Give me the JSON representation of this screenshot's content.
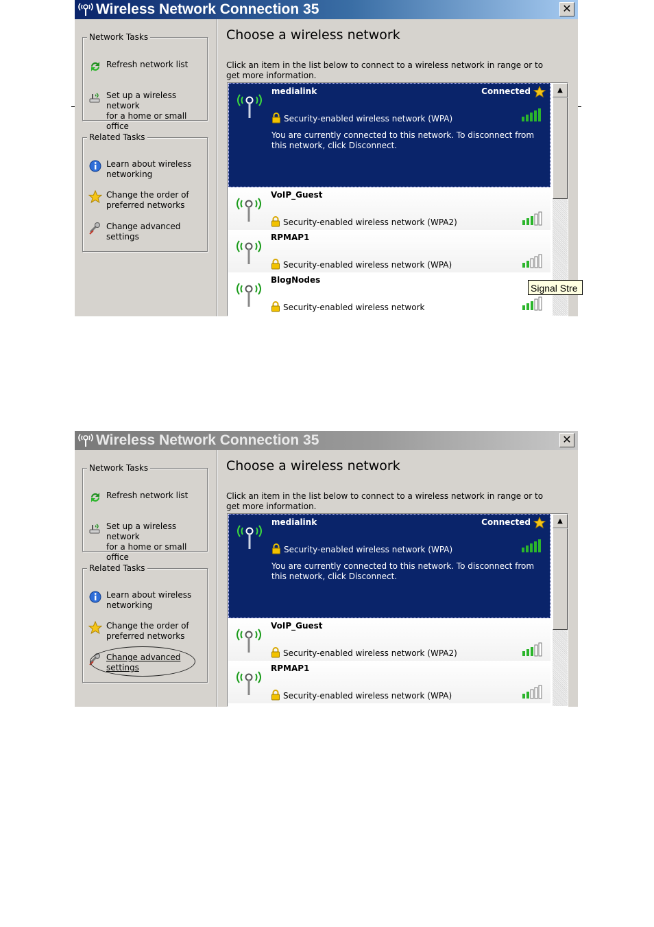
{
  "screenshots": [
    {
      "window_title": "Wireless Network Connection 35",
      "title_state": "active",
      "close_label": "✕",
      "network_tasks": {
        "legend": "Network Tasks",
        "items": [
          {
            "label": "Refresh network list",
            "icon": "refresh-icon"
          },
          {
            "label": "Set up a wireless network\nfor a home or small office",
            "icon": "setup-network-icon"
          }
        ]
      },
      "related_tasks": {
        "legend": "Related Tasks",
        "items": [
          {
            "label": "Learn about wireless\nnetworking",
            "icon": "info-icon"
          },
          {
            "label": "Change the order of\npreferred networks",
            "icon": "star-icon"
          },
          {
            "label": "Change advanced\nsettings",
            "icon": "advanced-settings-icon"
          }
        ]
      },
      "heading": "Choose a wireless network",
      "intro": "Click an item in the list below to connect to a wireless network in range or to get more information.",
      "networks": [
        {
          "ssid": "medialink",
          "status": "Connected",
          "security": "Security-enabled wireless network (WPA)",
          "signal_bars": 5,
          "description": "You are currently connected to this network. To disconnect from this network, click Disconnect.",
          "selected": true
        },
        {
          "ssid": "VoIP_Guest",
          "security": "Security-enabled wireless network (WPA2)",
          "signal_bars": 3
        },
        {
          "ssid": "RPMAP1",
          "security": "Security-enabled wireless network (WPA)",
          "signal_bars": 2
        },
        {
          "ssid": "BlogNodes",
          "security": "Security-enabled wireless network",
          "signal_bars": 3
        }
      ],
      "tooltip": "Signal Stre"
    },
    {
      "window_title": "Wireless Network Connection 35",
      "title_state": "inactive",
      "close_label": "✕",
      "network_tasks": {
        "legend": "Network Tasks",
        "items": [
          {
            "label": "Refresh network list",
            "icon": "refresh-icon"
          },
          {
            "label": "Set up a wireless network\nfor a home or small office",
            "icon": "setup-network-icon"
          }
        ]
      },
      "related_tasks": {
        "legend": "Related Tasks",
        "items": [
          {
            "label": "Learn about wireless\nnetworking",
            "icon": "info-icon"
          },
          {
            "label": "Change the order of\npreferred networks",
            "icon": "star-icon"
          },
          {
            "label": "Change advanced \nsettings",
            "icon": "advanced-settings-icon",
            "highlighted": true
          }
        ]
      },
      "heading": "Choose a wireless network",
      "intro": "Click an item in the list below to connect to a wireless network in range or to get more information.",
      "networks": [
        {
          "ssid": "medialink",
          "status": "Connected",
          "security": "Security-enabled wireless network (WPA)",
          "signal_bars": 5,
          "description": "You are currently connected to this network. To disconnect from this network, click Disconnect.",
          "selected": true
        },
        {
          "ssid": "VoIP_Guest",
          "security": "Security-enabled wireless network (WPA2)",
          "signal_bars": 3
        },
        {
          "ssid": "RPMAP1",
          "security": "Security-enabled wireless network (WPA)",
          "signal_bars": 2
        }
      ]
    }
  ],
  "colors": {
    "selection": "#0a246a",
    "signal_green": "#2bb52b",
    "antenna_green": "#1a9b1a",
    "face": "#d6d3ce"
  }
}
